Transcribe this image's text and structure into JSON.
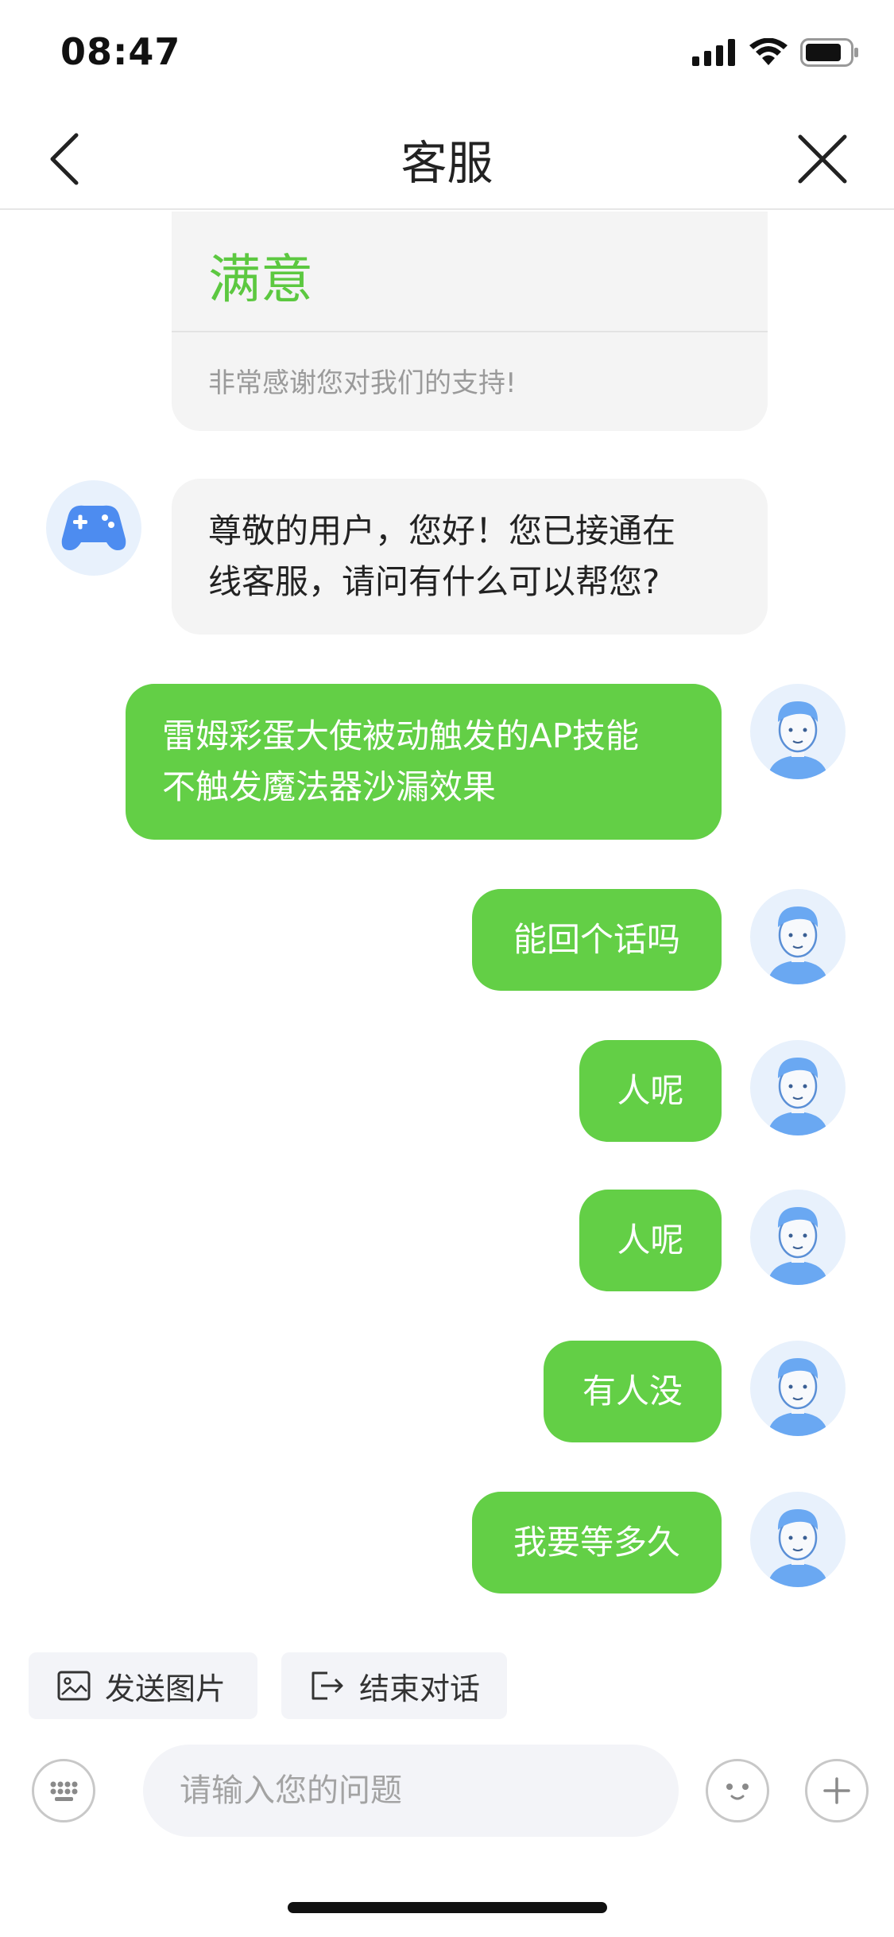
{
  "status_bar": {
    "time": "08:47"
  },
  "nav": {
    "title": "客服"
  },
  "evaluation": {
    "title": "满意",
    "note": "非常感谢您对我们的支持!"
  },
  "messages": [
    {
      "from": "agent",
      "lines": [
        "尊敬的用户，您好！您已接通在",
        "线客服，请问有什么可以帮您?"
      ]
    },
    {
      "from": "user",
      "lines": [
        "雷姆彩蛋大使被动触发的AP技能",
        "不触发魔法器沙漏效果"
      ]
    },
    {
      "from": "user",
      "lines": [
        "能回个话吗"
      ]
    },
    {
      "from": "user",
      "lines": [
        "人呢"
      ]
    },
    {
      "from": "user",
      "lines": [
        "人呢"
      ]
    },
    {
      "from": "user",
      "lines": [
        "有人没"
      ]
    },
    {
      "from": "user",
      "lines": [
        "我要等多久"
      ]
    }
  ],
  "actions": {
    "send_image": "发送图片",
    "end_chat": "结束对话"
  },
  "input": {
    "placeholder": "请输入您的问题"
  },
  "colors": {
    "accent_green": "#63cf46",
    "title_green": "#5cc840",
    "agent_bubble": "#f4f4f4",
    "avatar_bg": "#e8f1fc"
  },
  "icons": [
    "back-icon",
    "close-icon",
    "gamepad-icon",
    "user-avatar-icon",
    "image-icon",
    "exit-icon",
    "keyboard-icon",
    "emoji-icon",
    "plus-icon"
  ]
}
